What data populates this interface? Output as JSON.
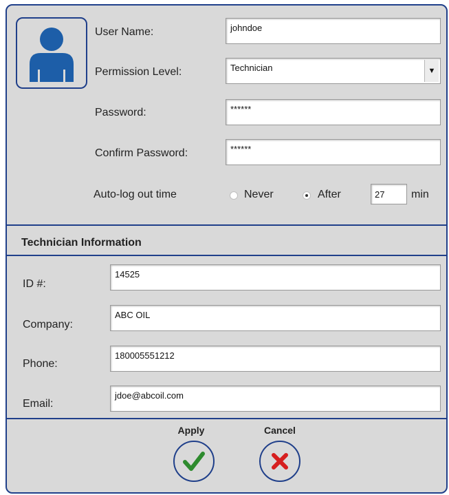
{
  "user": {
    "username_label": "User Name:",
    "username_value": "johndoe",
    "permission_label": "Permission Level:",
    "permission_value": "Technician",
    "password_label": "Password:",
    "password_value": "******",
    "confirm_label": "Confirm Password:",
    "confirm_value": "******",
    "autologout_label": "Auto-log out time",
    "never_label": "Never",
    "after_label": "After",
    "after_selected": true,
    "minutes_value": "27",
    "minutes_unit": "min"
  },
  "technician": {
    "section_title": "Technician Information",
    "id_label": "ID #:",
    "id_value": "14525",
    "company_label": "Company:",
    "company_value": "ABC OIL",
    "phone_label": "Phone:",
    "phone_value": "180005551212",
    "email_label": "Email:",
    "email_value": "jdoe@abcoil.com"
  },
  "actions": {
    "apply_label": "Apply",
    "cancel_label": "Cancel"
  },
  "icons": {
    "avatar": "user-icon",
    "dropdown": "caret-down-icon",
    "apply": "checkmark-icon",
    "cancel": "x-icon"
  },
  "colors": {
    "accent": "#1f3f8a",
    "check": "#2e8b2e",
    "cancel": "#d61f1f",
    "panel_bg": "#d9d9d9"
  }
}
